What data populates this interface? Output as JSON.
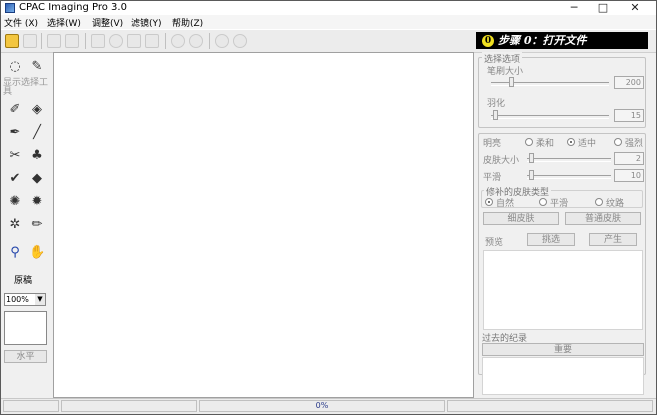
{
  "window": {
    "title": "CPAC Imaging Pro 3.0",
    "minimize_glyph": "─",
    "maximize_glyph": "□",
    "close_glyph": "✕"
  },
  "menu": [
    {
      "label": "文件 (X)"
    },
    {
      "label": "选择(W)"
    },
    {
      "label": "调整(V)"
    },
    {
      "label": "滤镜(Y)"
    },
    {
      "label": "帮助(Z)"
    }
  ],
  "step_banner": {
    "number": "0",
    "text": "步骤 0：打开文件"
  },
  "left_panel": {
    "show_tools_label": "显示选择工具",
    "original_label": "原稿",
    "zoom_value": "100%",
    "horizontal_button": "水平"
  },
  "selection_options": {
    "title": "选择选项",
    "brush_size_label": "笔刷大小",
    "brush_size_value": "200",
    "feather_label": "羽化",
    "feather_value": "15"
  },
  "skin": {
    "brightness_label": "明亮",
    "brightness_options": [
      "柔和",
      "适中",
      "强烈"
    ],
    "brightness_selected": 1,
    "skin_size_label": "皮肤大小",
    "skin_size_value": "2",
    "smooth_label": "平滑",
    "smooth_value": "10",
    "patch_type_title": "修补的皮肤类型",
    "patch_options": [
      "自然",
      "平滑",
      "纹路"
    ],
    "patch_selected": 0,
    "fine_skin_button": "细皮肤",
    "normal_skin_button": "普通皮肤",
    "preview_label": "预览",
    "pick_button": "挑选",
    "generate_button": "产生"
  },
  "history": {
    "title": "过去的纪录",
    "redo_button": "重要"
  },
  "status": {
    "progress": "0%"
  },
  "colors": {
    "accent": "#000000",
    "banner_badge": "#f0e020"
  }
}
